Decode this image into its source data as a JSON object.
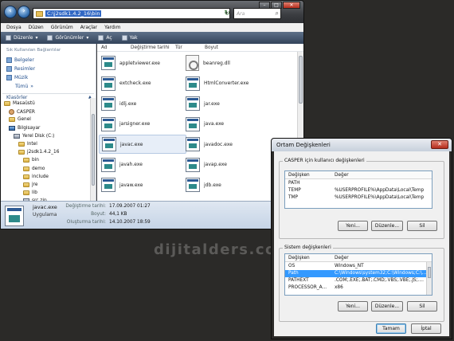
{
  "explorer": {
    "address": "C:\\j2sdk1.4.2_16\\bin",
    "search_placeholder": "Ara",
    "menu": [
      "Dosya",
      "Düzen",
      "Görünüm",
      "Araçlar",
      "Yardım"
    ],
    "toolbar": [
      "Düzenle",
      "Görünümler",
      "Aç",
      "Yak"
    ],
    "favorites_heading": "Sık Kullanılan Bağlantılar",
    "favorites": [
      "Belgeler",
      "Resimler",
      "Müzik",
      "Tümü"
    ],
    "folders_heading": "Klasörler",
    "tree": [
      {
        "label": "Masaüstü",
        "indent": 0,
        "icon": "folder"
      },
      {
        "label": "CASPER",
        "indent": 1,
        "icon": "user"
      },
      {
        "label": "Genel",
        "indent": 1,
        "icon": "folder"
      },
      {
        "label": "Bilgisayar",
        "indent": 1,
        "icon": "computer"
      },
      {
        "label": "Yerel Disk (C:)",
        "indent": 2,
        "icon": "drive"
      },
      {
        "label": "Intel",
        "indent": 3,
        "icon": "folder"
      },
      {
        "label": "j2sdk1.4.2_16",
        "indent": 3,
        "icon": "folder"
      },
      {
        "label": "bin",
        "indent": 4,
        "icon": "folder"
      },
      {
        "label": "demo",
        "indent": 4,
        "icon": "folder"
      },
      {
        "label": "include",
        "indent": 4,
        "icon": "folder"
      },
      {
        "label": "jre",
        "indent": 4,
        "icon": "folder"
      },
      {
        "label": "lib",
        "indent": 4,
        "icon": "folder"
      },
      {
        "label": "src.zip",
        "indent": 4,
        "icon": "zip"
      },
      {
        "label": "Kullanıcılar",
        "indent": 3,
        "icon": "folder"
      }
    ],
    "columns": [
      "Ad",
      "Değiştirme tarihi",
      "Tür",
      "Boyut"
    ],
    "files_left": [
      "appletviewer.exe",
      "extcheck.exe",
      "idlj.exe",
      "jarsigner.exe",
      "javac.exe",
      "javah.exe",
      "javaw.exe"
    ],
    "files_right": [
      "beanreg.dll",
      "HtmlConverter.exe",
      "jar.exe",
      "java.exe",
      "javadoc.exe",
      "javap.exe",
      "jdb.exe"
    ],
    "selected_file": "javac.exe",
    "details": {
      "name": "javac.exe",
      "type": "Uygulama",
      "modified_label": "Değiştirme tarihi:",
      "modified": "17.09.2007 01:27",
      "size_label": "Boyut:",
      "size": "44,1 KB",
      "created_label": "Oluşturma tarihi:",
      "created": "14.10.2007 18:59"
    }
  },
  "watermark": "dijitalders.com",
  "dialog": {
    "title": "Ortam Değişkenleri",
    "user_group": "CASPER için kullanıcı değişkenleri",
    "col_var": "Değişken",
    "col_val": "Değer",
    "user_vars": [
      {
        "name": "PATH",
        "value": ""
      },
      {
        "name": "TEMP",
        "value": "%USERPROFILE%\\AppData\\Local\\Temp"
      },
      {
        "name": "TMP",
        "value": "%USERPROFILE%\\AppData\\Local\\Temp"
      }
    ],
    "system_group": "Sistem değişkenleri",
    "system_vars": [
      {
        "name": "OS",
        "value": "Windows_NT"
      },
      {
        "name": "Path",
        "value": "C:\\Windows\\system32;C:\\Windows;C:\\..."
      },
      {
        "name": "PATHEXT",
        "value": ".COM;.EXE;.BAT;.CMD;.VBS;.VBE;.JS;...."
      },
      {
        "name": "PROCESSOR_A...",
        "value": "x86"
      }
    ],
    "selected_system": "Path",
    "btn_new": "Yeni...",
    "btn_edit": "Düzenle...",
    "btn_delete": "Sil",
    "btn_ok": "Tamam",
    "btn_cancel": "İptal"
  }
}
